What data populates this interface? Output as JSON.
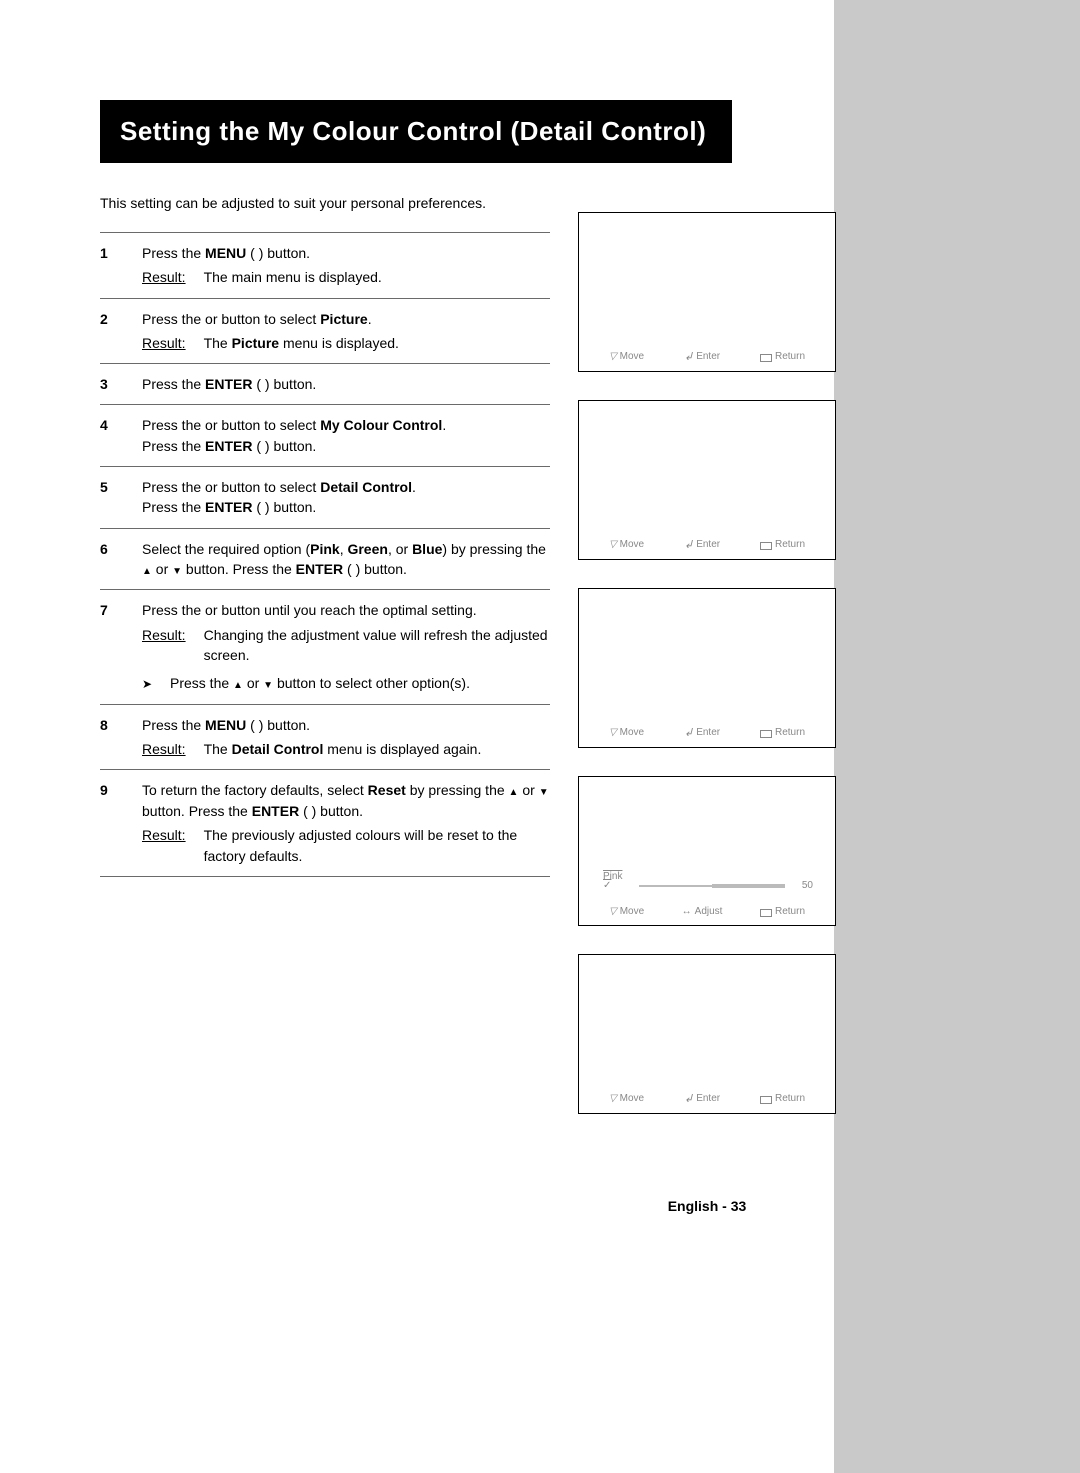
{
  "title": "Setting the My Colour Control (Detail Control)",
  "intro": "This setting can be adjusted to suit your personal preferences.",
  "steps": {
    "n1": "1",
    "s1a": "Press the ",
    "s1_menu": "MENU",
    "s1b": " (        ) button.",
    "s1_result": "The main menu is displayed.",
    "n2": "2",
    "s2a": "Press the     or     button to select ",
    "s2_picture": "Picture",
    "s2b": ".",
    "s2_result_a": "The ",
    "s2_result_picture": "Picture",
    "s2_result_b": " menu is displayed.",
    "n3": "3",
    "s3a": "Press the ",
    "s3_enter": "ENTER",
    "s3b": " (        ) button.",
    "n4": "4",
    "s4a": "Press the     or     button to select ",
    "s4_mcc": "My Colour Control",
    "s4b": ".",
    "s4c": "Press the ",
    "s4_enter": "ENTER",
    "s4d": " (        ) button.",
    "n5": "5",
    "s5a": "Press the     or     button to select ",
    "s5_dc": "Detail Control",
    "s5b": ".",
    "s5c": "Press the ",
    "s5_enter": "ENTER",
    "s5d": " (        ) button.",
    "n6": "6",
    "s6a": "Select the required option (",
    "s6_pink": "Pink",
    "s6b": ", ",
    "s6_green": "Green",
    "s6c": ", or ",
    "s6_blue": "Blue",
    "s6d": ") by pressing the ",
    "s6_or": " or ",
    "s6e": " button. Press the ",
    "s6_enter": "ENTER",
    "s6f": " (        ) button.",
    "n7": "7",
    "s7a": "Press the     or     button until you reach the optimal setting.",
    "s7_result": "Changing the adjustment value will refresh the adjusted screen.",
    "s7_note_a": "Press the ",
    "s7_note_or": " or ",
    "s7_note_b": " button to select other option(s).",
    "n8": "8",
    "s8a": "Press the ",
    "s8_menu": "MENU",
    "s8b": " (        ) button.",
    "s8_result_a": "The ",
    "s8_result_dc": "Detail Control",
    "s8_result_b": " menu is displayed again.",
    "n9": "9",
    "s9a": "To return the factory defaults, select ",
    "s9_reset": "Reset",
    "s9b": " by pressing the ",
    "s9_or": " or ",
    "s9c": " button. Press the ",
    "s9_enter": "ENTER",
    "s9d": " (        ) button.",
    "s9_result": "The previously adjusted colours will be reset to the factory defaults."
  },
  "result_label": "Result:",
  "osd": {
    "move": "Move",
    "enter": "Enter",
    "return": "Return",
    "adjust": "Adjust",
    "pink_label": "Pink",
    "pink_value": "50"
  },
  "footer": "English - 33"
}
